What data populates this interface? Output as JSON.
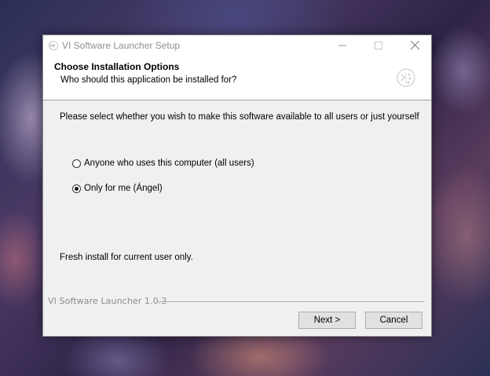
{
  "window": {
    "title": "VI Software Launcher Setup"
  },
  "header": {
    "title": "Choose Installation Options",
    "subtitle": "Who should this application be installed for?"
  },
  "content": {
    "instructions": "Please select whether you wish to make this software available to all users or just yourself",
    "options": [
      {
        "label": "Anyone who uses this computer (all users)",
        "selected": false
      },
      {
        "label": "Only for me (Ángel)",
        "selected": true
      }
    ],
    "status": "Fresh install for current user only."
  },
  "footer": {
    "branding": "VI Software Launcher 1.0.2",
    "next_label": "Next >",
    "cancel_label": "Cancel"
  },
  "icons": {
    "app": "installer-icon",
    "header": "installer-logo-icon",
    "minimize": "minimize-icon",
    "maximize": "maximize-icon",
    "close": "close-icon"
  }
}
